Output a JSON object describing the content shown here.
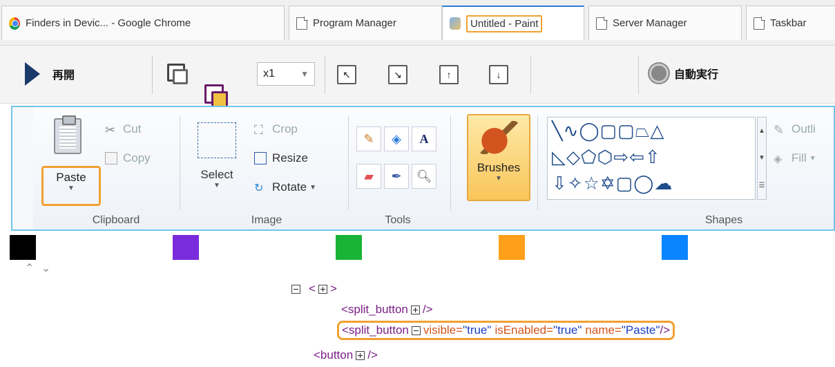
{
  "tabs": [
    {
      "label": "Finders in Devic... - Google Chrome",
      "icon": "chrome-icon"
    },
    {
      "label": "Program Manager",
      "icon": "document-icon"
    },
    {
      "label": "Untitled - Paint",
      "icon": "paint-icon",
      "active": true
    },
    {
      "label": "Server Manager",
      "icon": "document-icon"
    },
    {
      "label": "Taskbar",
      "icon": "document-icon"
    }
  ],
  "toolbar": {
    "resume_label": "再開",
    "speed_value": "x1",
    "auto_run_label": "自動実行"
  },
  "ribbon": {
    "clipboard": {
      "label": "Clipboard",
      "paste": "Paste",
      "cut": "Cut",
      "copy": "Copy"
    },
    "image": {
      "label": "Image",
      "select": "Select",
      "crop": "Crop",
      "resize": "Resize",
      "rotate": "Rotate"
    },
    "tools": {
      "label": "Tools"
    },
    "brushes": {
      "label": "Brushes"
    },
    "shapes": {
      "label": "Shapes",
      "outline": "Outli",
      "fill": "Fill",
      "rows": [
        "╲∿◯▢▢⏢△",
        "◺◇⬠⬡⇨⇦⇧",
        "⇩✧☆✡▢◯☁"
      ]
    }
  },
  "palette": {
    "colors": [
      "#000000",
      "#7a2bdc",
      "#19b336",
      "#ff9f1a",
      "#0a84ff"
    ]
  },
  "tree": {
    "root_open": "<",
    "root_close": ">",
    "node1": {
      "tag": "<split_button",
      "close": "/>"
    },
    "node2": {
      "tag": "<split_button",
      "a1": "visible=",
      "v1": "\"true\"",
      "a2": "isEnabled=",
      "v2": "\"true\"",
      "a3": "name=",
      "v3": "\"Paste\"",
      "close": "/>"
    },
    "node3": {
      "tag": "<button",
      "close": "/>"
    }
  }
}
